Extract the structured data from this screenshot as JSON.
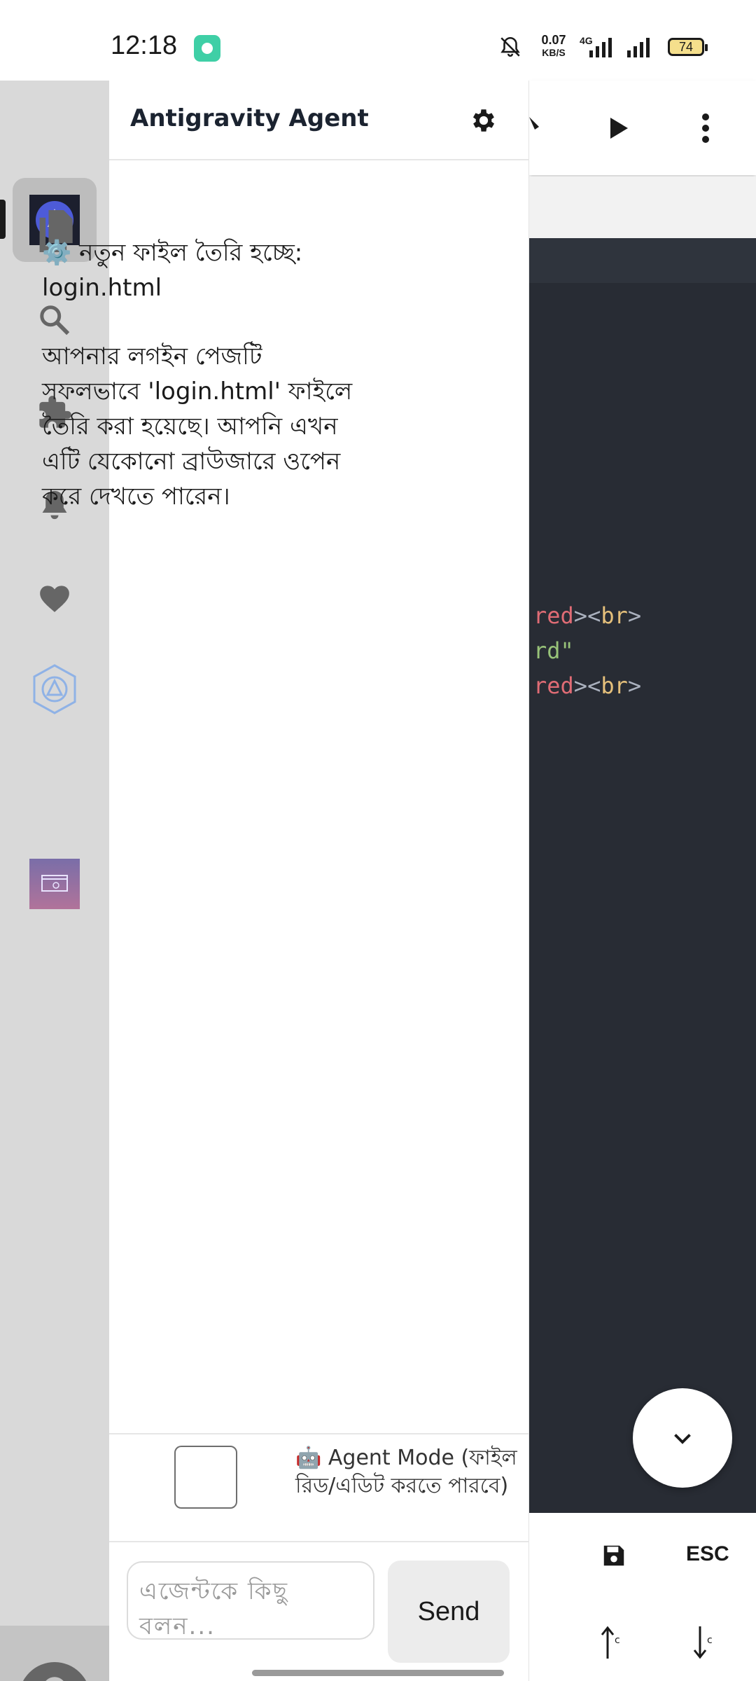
{
  "status_bar": {
    "time": "12:18",
    "net_speed_value": "0.07",
    "net_speed_unit": "KB/S",
    "network_type": "4G",
    "battery_level": "74"
  },
  "editor": {
    "code_lines": [
      {
        "attr": "red",
        "rest": "><",
        "tag": "br",
        "end": ">"
      },
      {
        "string": "rd\""
      },
      {
        "attr": "red",
        "rest": "><",
        "tag": "br",
        "end": ">"
      }
    ],
    "save_icon": "save-icon",
    "esc_label": "ESC",
    "colors": {
      "background": "#282c34",
      "attr": "#e06c75",
      "tag": "#e5c07b",
      "string": "#98c379"
    }
  },
  "activity_bar": {
    "items": [
      "antigravity-logo",
      "files-icon",
      "search-icon",
      "extensions-icon",
      "notifications-icon",
      "favorites-icon",
      "ai-hex-icon",
      "app-thumbnail"
    ],
    "account_icon": "account-icon"
  },
  "agent_panel": {
    "title": "Antigravity Agent",
    "messages": [
      {
        "icon": "⚙️",
        "text": "নতুন ফাইল তৈরি হচ্ছে: login.html"
      },
      {
        "text": "আপনার লগইন পেজটি সফলভাবে 'login.html' ফাইলে তৈরি করা হয়েছে। আপনি এখন এটি যেকোনো ব্রাউজারে ওপেন করে দেখতে পারেন।"
      }
    ],
    "agent_mode_label": "🤖 Agent Mode (ফাইল রিড/এডিট করতে পারবে)",
    "agent_mode_checked": false,
    "input_placeholder": "এজেন্টকে কিছু বলন...",
    "send_label": "Send"
  }
}
